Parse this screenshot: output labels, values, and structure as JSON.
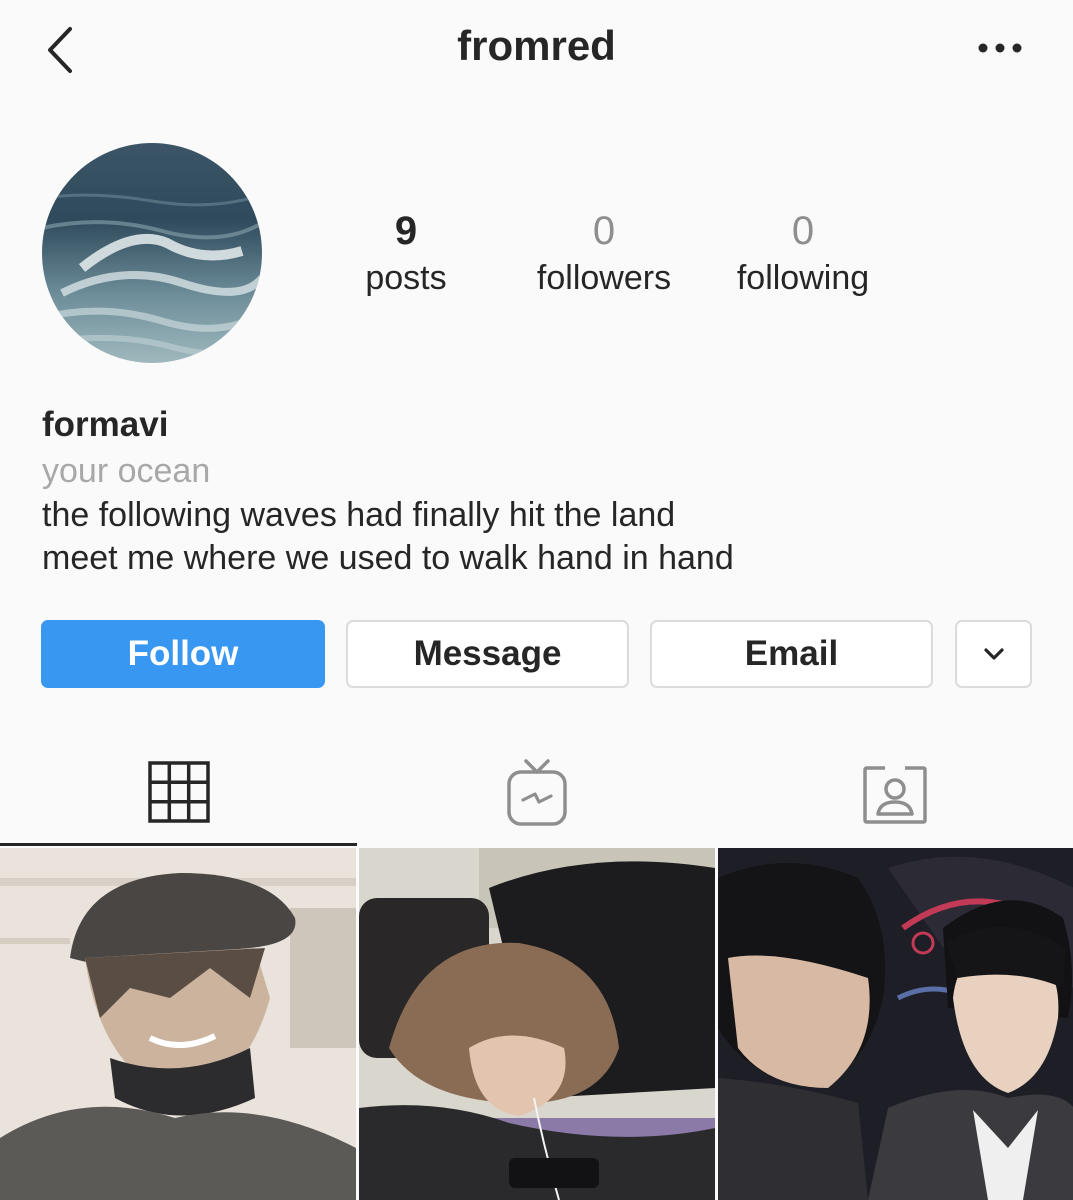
{
  "header": {
    "back_icon": "chevron-left-icon",
    "username": "fromred",
    "more_icon": "ellipsis-icon"
  },
  "profile": {
    "avatar": "ocean-wave-photo",
    "stats": {
      "posts_count": "9",
      "posts_label": "posts",
      "followers_count": "0",
      "followers_label": "followers",
      "following_count": "0",
      "following_label": "following"
    },
    "display_name": "formavi",
    "category": "your ocean",
    "bio_lines": [
      "the following waves had finally hit the land",
      "meet me where we used to walk hand in hand"
    ]
  },
  "actions": {
    "follow_label": "Follow",
    "message_label": "Message",
    "email_label": "Email",
    "more_icon": "chevron-down-icon",
    "follow_color": "#3897f0"
  },
  "tabs": [
    {
      "name": "grid",
      "icon": "grid-icon",
      "active": true
    },
    {
      "name": "igtv",
      "icon": "igtv-icon",
      "active": false
    },
    {
      "name": "tagged",
      "icon": "tagged-person-icon",
      "active": false
    }
  ],
  "posts": [
    {
      "thumbnail": "person-in-cap-with-mask-photo"
    },
    {
      "thumbnail": "person-sleeping-on-table-photo"
    },
    {
      "thumbnail": "two-people-photo"
    }
  ]
}
